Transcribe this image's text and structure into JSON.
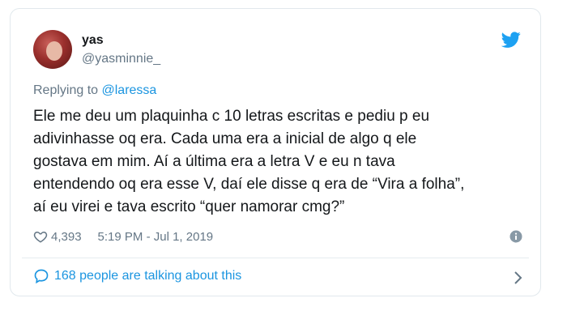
{
  "author": {
    "name": "yas",
    "handle": "@yasminnie_"
  },
  "reply": {
    "prefix": "Replying to ",
    "mention": "@laressa"
  },
  "tweet": {
    "text": "Ele me deu um plaquinha c 10 letras escritas e pediu p eu\nadivinhasse oq era. Cada uma era a inicial de algo q ele\ngostava em mim. Aí a última era a letra V e eu n tava\nentendendo oq era esse V, daí ele disse q era de “Vira a folha”,\naí eu virei e tava escrito “quer namorar cmg?”",
    "likes": "4,393",
    "timestamp": "5:19 PM - Jul 1, 2019"
  },
  "footer": {
    "talking": "168 people are talking about this"
  },
  "colors": {
    "accent": "#1b95e0",
    "muted": "#657786",
    "text": "#14171a",
    "twitter_blue": "#1da1f2"
  },
  "icons": [
    "twitter-bird-icon",
    "heart-icon",
    "info-icon",
    "speech-bubble-icon",
    "chevron-right-icon"
  ]
}
